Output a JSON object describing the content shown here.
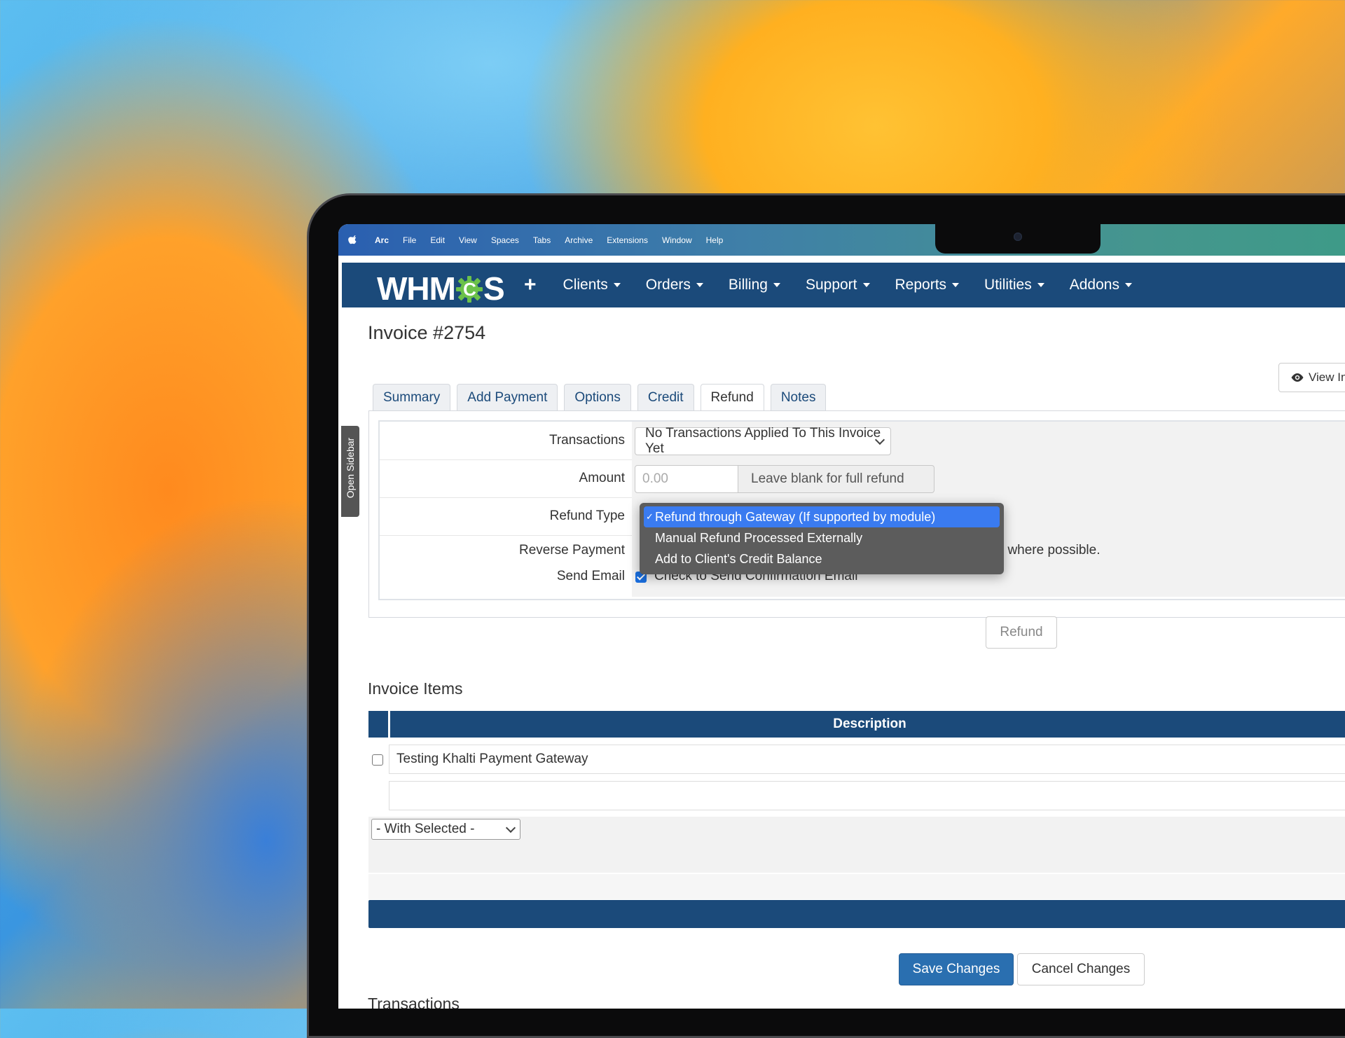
{
  "macos_menu": {
    "app": "Arc",
    "items": [
      "File",
      "Edit",
      "View",
      "Spaces",
      "Tabs",
      "Archive",
      "Extensions",
      "Window",
      "Help"
    ]
  },
  "navbar": {
    "logo": "WHMCS",
    "items": [
      "Clients",
      "Orders",
      "Billing",
      "Support",
      "Reports",
      "Utilities",
      "Addons"
    ]
  },
  "sidebar": {
    "open_label": "Open Sidebar"
  },
  "page": {
    "title": "Invoice #2754",
    "view_button": "View In"
  },
  "tabs": [
    "Summary",
    "Add Payment",
    "Options",
    "Credit",
    "Refund",
    "Notes"
  ],
  "active_tab": "Refund",
  "refund_form": {
    "transactions_label": "Transactions",
    "transactions_value": "No Transactions Applied To This Invoice Yet",
    "amount_label": "Amount",
    "amount_placeholder": "0.00",
    "amount_addon": "Leave blank for full refund",
    "refund_type_label": "Refund Type",
    "refund_type_options": [
      "Refund through Gateway (If supported by module)",
      "Manual Refund Processed Externally",
      "Add to Client's Credit Balance"
    ],
    "refund_type_selected_index": 0,
    "reverse_payment_label": "Reverse Payment",
    "reverse_payment_text_visible": "n - where possible.",
    "send_email_label": "Send Email",
    "send_email_text": "Check to Send Confirmation Email",
    "send_email_checked": true,
    "refund_button": "Refund"
  },
  "invoice_items": {
    "heading": "Invoice Items",
    "column_description": "Description",
    "rows": [
      "Testing Khalti Payment Gateway",
      ""
    ],
    "with_selected": "- With Selected -"
  },
  "actions": {
    "save": "Save Changes",
    "cancel": "Cancel Changes"
  },
  "transactions_heading": "Transactions"
}
